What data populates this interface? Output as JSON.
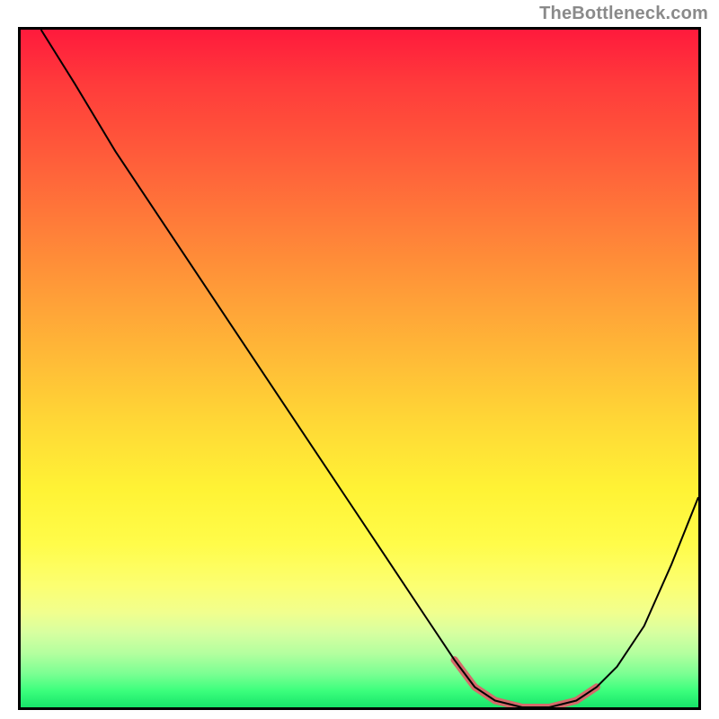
{
  "attribution": "TheBottleneck.com",
  "chart_data": {
    "type": "line",
    "title": "",
    "xlabel": "",
    "ylabel": "",
    "xlim": [
      0,
      100
    ],
    "ylim": [
      0,
      100
    ],
    "curve": {
      "name": "bottleneck-curve",
      "color": "#000000",
      "width": 2,
      "points": [
        {
          "x": 3,
          "y": 100
        },
        {
          "x": 8,
          "y": 92
        },
        {
          "x": 14,
          "y": 82
        },
        {
          "x": 22,
          "y": 70
        },
        {
          "x": 30,
          "y": 58
        },
        {
          "x": 38,
          "y": 46
        },
        {
          "x": 46,
          "y": 34
        },
        {
          "x": 54,
          "y": 22
        },
        {
          "x": 60,
          "y": 13
        },
        {
          "x": 64,
          "y": 7
        },
        {
          "x": 67,
          "y": 3
        },
        {
          "x": 70,
          "y": 1
        },
        {
          "x": 74,
          "y": 0
        },
        {
          "x": 78,
          "y": 0
        },
        {
          "x": 82,
          "y": 1
        },
        {
          "x": 85,
          "y": 3
        },
        {
          "x": 88,
          "y": 6
        },
        {
          "x": 92,
          "y": 12
        },
        {
          "x": 96,
          "y": 21
        },
        {
          "x": 100,
          "y": 31
        }
      ]
    },
    "highlight": {
      "name": "optimal-range",
      "color": "#d46a6a",
      "width": 8,
      "cap": "round",
      "points": [
        {
          "x": 64,
          "y": 7
        },
        {
          "x": 67,
          "y": 3
        },
        {
          "x": 70,
          "y": 1
        },
        {
          "x": 74,
          "y": 0
        },
        {
          "x": 78,
          "y": 0
        },
        {
          "x": 82,
          "y": 1
        },
        {
          "x": 85,
          "y": 3
        }
      ]
    },
    "gradient_stops": [
      {
        "pos": 0,
        "color": "#ff1a3c"
      },
      {
        "pos": 0.5,
        "color": "#ffd836"
      },
      {
        "pos": 0.82,
        "color": "#fcff71"
      },
      {
        "pos": 1.0,
        "color": "#17e56a"
      }
    ]
  }
}
